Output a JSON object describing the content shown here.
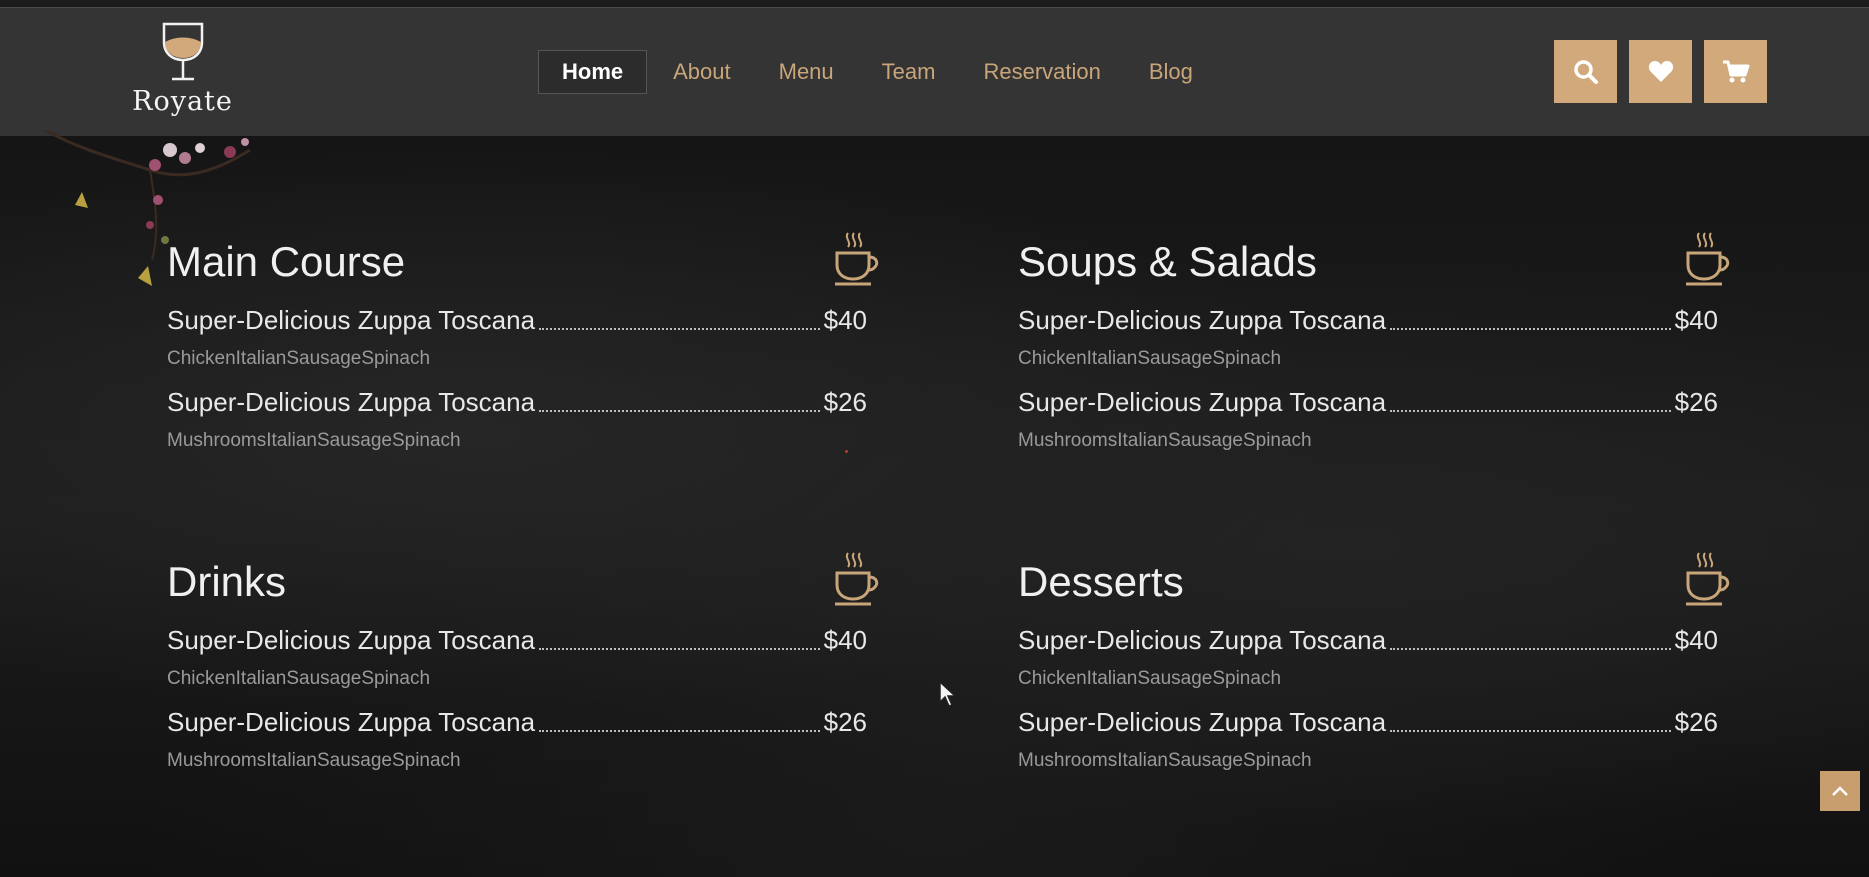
{
  "brand": {
    "name": "Royate"
  },
  "nav": {
    "items": [
      {
        "label": "Home",
        "active": true
      },
      {
        "label": "About"
      },
      {
        "label": "Menu"
      },
      {
        "label": "Team"
      },
      {
        "label": "Reservation"
      },
      {
        "label": "Blog"
      }
    ]
  },
  "tools": {
    "icons": [
      "search-icon",
      "heart-icon",
      "cart-icon"
    ]
  },
  "colors": {
    "accent": "#d1a97b",
    "header": "#343434",
    "background": "#141414"
  },
  "menu": {
    "sections": [
      {
        "title": "Main Course",
        "items": [
          {
            "name": "Super-Delicious Zuppa Toscana",
            "price": "$40",
            "desc": "ChickenItalianSausageSpinach"
          },
          {
            "name": "Super-Delicious Zuppa Toscana",
            "price": "$26",
            "desc": "MushroomsItalianSausageSpinach"
          }
        ]
      },
      {
        "title": "Soups & Salads",
        "items": [
          {
            "name": "Super-Delicious Zuppa Toscana",
            "price": "$40",
            "desc": "ChickenItalianSausageSpinach"
          },
          {
            "name": "Super-Delicious Zuppa Toscana",
            "price": "$26",
            "desc": "MushroomsItalianSausageSpinach"
          }
        ]
      },
      {
        "title": "Drinks",
        "items": [
          {
            "name": "Super-Delicious Zuppa Toscana",
            "price": "$40",
            "desc": "ChickenItalianSausageSpinach"
          },
          {
            "name": "Super-Delicious Zuppa Toscana",
            "price": "$26",
            "desc": "MushroomsItalianSausageSpinach"
          }
        ]
      },
      {
        "title": "Desserts",
        "items": [
          {
            "name": "Super-Delicious Zuppa Toscana",
            "price": "$40",
            "desc": "ChickenItalianSausageSpinach"
          },
          {
            "name": "Super-Delicious Zuppa Toscana",
            "price": "$26",
            "desc": "MushroomsItalianSausageSpinach"
          }
        ]
      }
    ]
  }
}
